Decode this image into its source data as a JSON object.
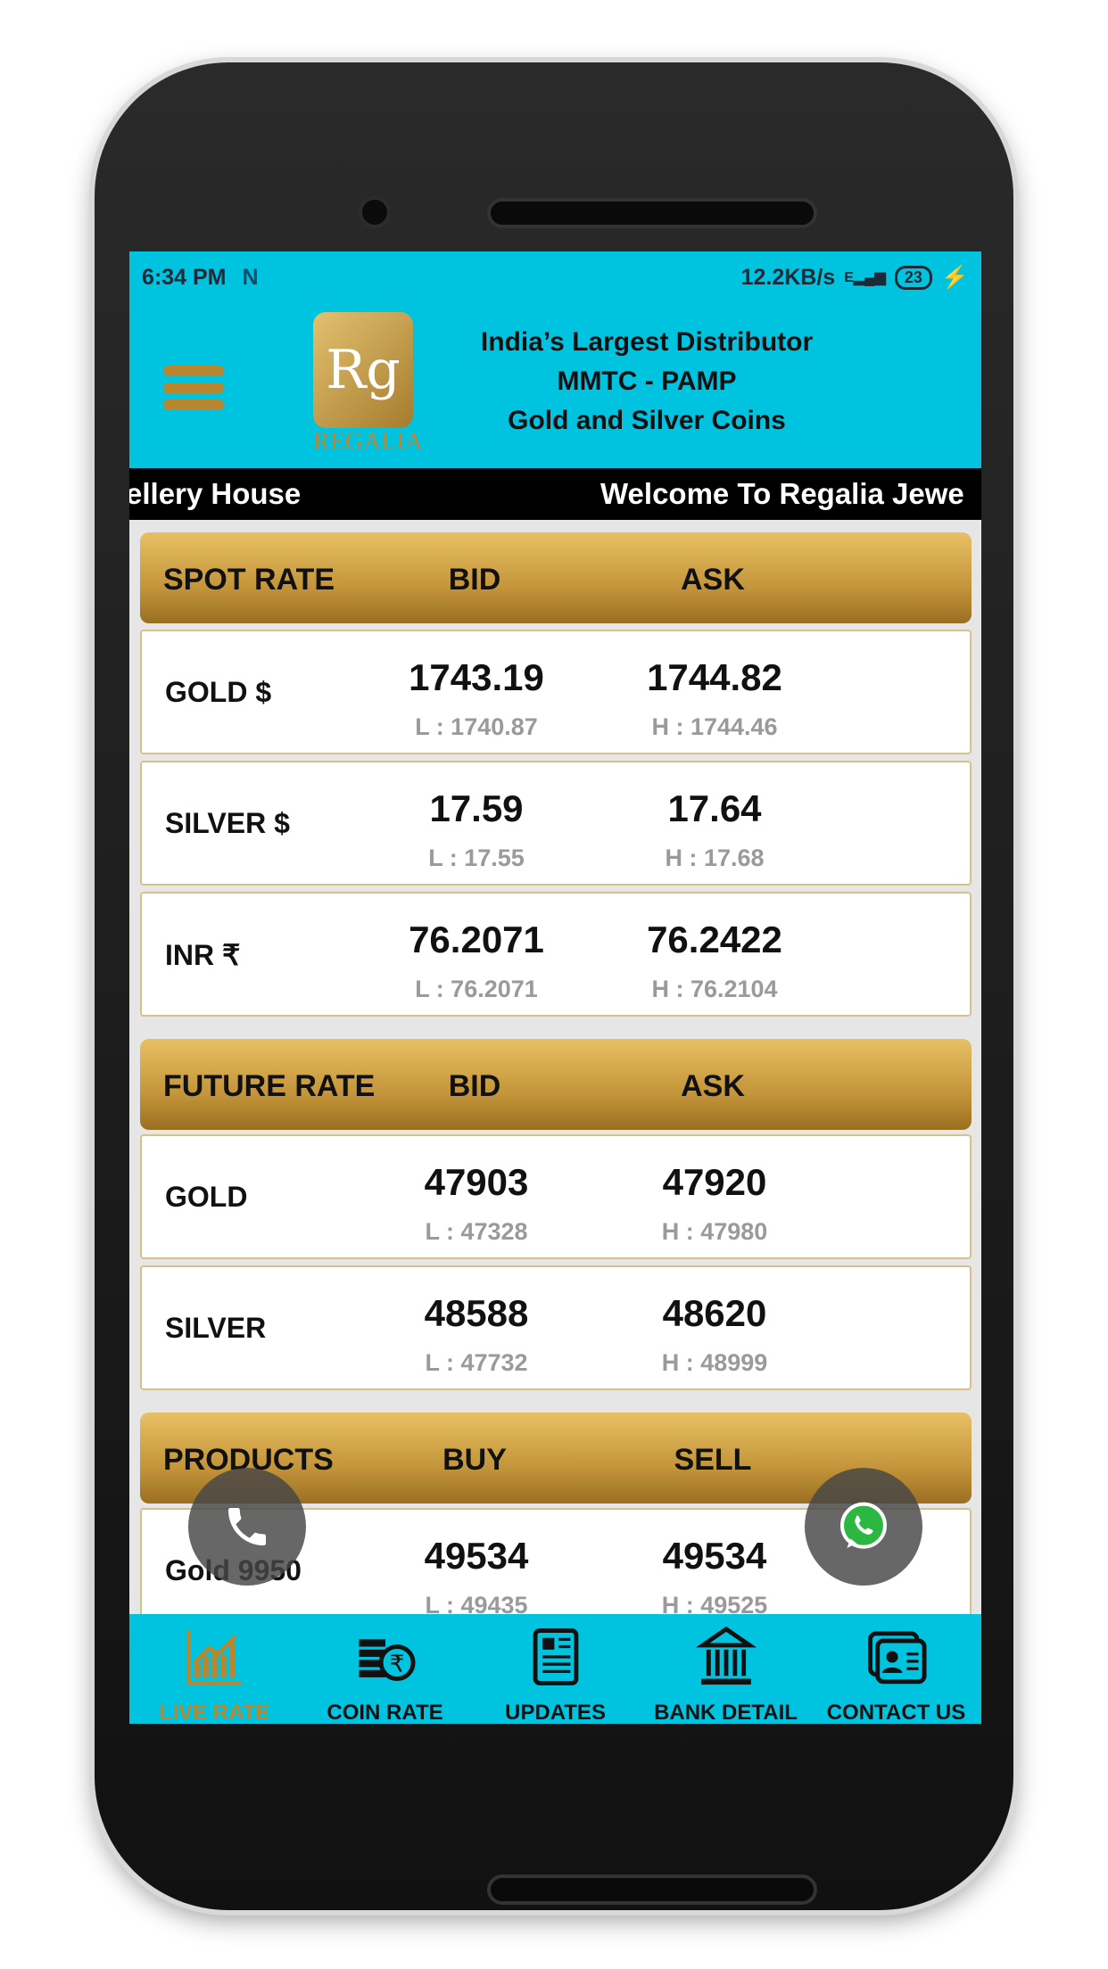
{
  "status": {
    "time": "6:34 PM",
    "network_speed": "12.2KB/s",
    "network_type": "E",
    "battery": "23"
  },
  "header": {
    "logo_text": "REGALIA",
    "tagline": [
      "India’s Largest Distributor",
      "MMTC - PAMP",
      "Gold and Silver Coins"
    ]
  },
  "marquee": {
    "text_left": "ellery House",
    "text_right": "Welcome To Regalia Jewe"
  },
  "spot": {
    "title": "SPOT RATE",
    "col1": "BID",
    "col2": "ASK",
    "rows": [
      {
        "name": "GOLD $",
        "bid": "1743.19",
        "ask": "1744.82",
        "low": "L : 1740.87",
        "high": "H : 1744.46"
      },
      {
        "name": "SILVER $",
        "bid": "17.59",
        "ask": "17.64",
        "low": "L : 17.55",
        "high": "H : 17.68"
      },
      {
        "name": "INR ₹",
        "bid": "76.2071",
        "ask": "76.2422",
        "low": "L : 76.2071",
        "high": "H : 76.2104"
      }
    ]
  },
  "future": {
    "title": "FUTURE RATE",
    "col1": "BID",
    "col2": "ASK",
    "rows": [
      {
        "name": "GOLD",
        "bid": "47903",
        "ask": "47920",
        "low": "L : 47328",
        "high": "H : 47980"
      },
      {
        "name": "SILVER",
        "bid": "48588",
        "ask": "48620",
        "low": "L : 47732",
        "high": "H : 48999"
      }
    ]
  },
  "products": {
    "title": "PRODUCTS",
    "col1": "BUY",
    "col2": "SELL",
    "rows": [
      {
        "name": "Gold 9950",
        "bid": "49534",
        "ask": "49534",
        "low": "L : 49435",
        "high": "H : 49525"
      }
    ]
  },
  "nav": [
    {
      "label": "LIVE RATE",
      "icon": "chart-icon",
      "active": true
    },
    {
      "label": "COIN RATE",
      "icon": "coins-rupee-icon"
    },
    {
      "label": "UPDATES",
      "icon": "newspaper-icon"
    },
    {
      "label": "BANK DETAIL",
      "icon": "bank-icon"
    },
    {
      "label": "CONTACT US",
      "icon": "contact-card-icon"
    }
  ],
  "colors": {
    "accent": "#00c3df",
    "gold": "#c4953a",
    "active_nav": "#b8862e"
  }
}
